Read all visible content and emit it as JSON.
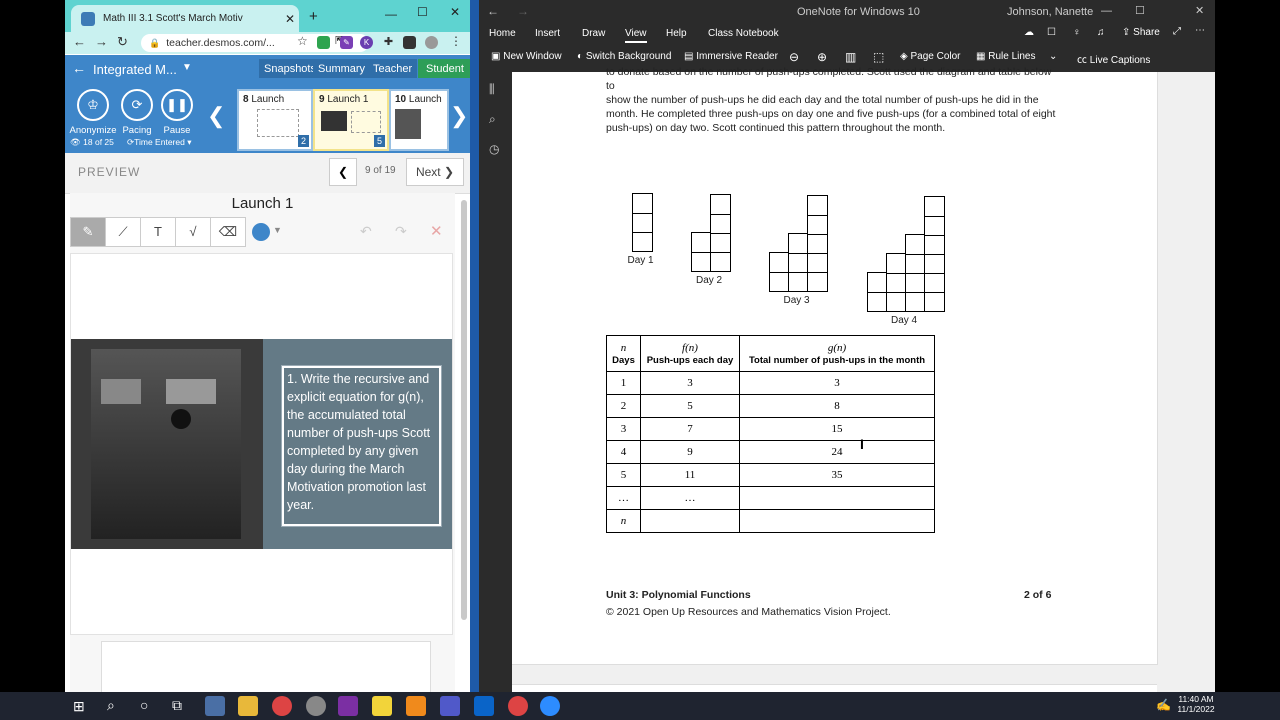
{
  "chrome": {
    "tab_title": "Math III 3.1 Scott's March Motiv",
    "url": "teacher.desmos.com/...",
    "new_tab": "+",
    "win_min": "—",
    "win_max": "☐",
    "win_close": "✕"
  },
  "desmos": {
    "activity_title": "Integrated M...",
    "tabs": [
      "Snapshots",
      "Summary",
      "Teacher",
      "Student"
    ],
    "tools": [
      {
        "label": "Anonymize",
        "icon": "♔"
      },
      {
        "label": "Pacing",
        "icon": "⟳"
      },
      {
        "label": "Pause",
        "icon": "❚❚"
      }
    ],
    "students_count": "18 of 25",
    "sort_label": "Time Entered",
    "slides": [
      {
        "num": "8",
        "name": "Launch",
        "count": "2"
      },
      {
        "num": "9",
        "name": "Launch 1",
        "count": "5"
      },
      {
        "num": "10",
        "name": "Launch",
        "count": ""
      }
    ],
    "preview_label": "PREVIEW",
    "page_indicator": "9 of 19",
    "next_label": "Next",
    "screen_title": "Launch 1",
    "sketch_tools": [
      "✎",
      "⟋",
      "T",
      "√",
      "⌫"
    ],
    "question": "1. Write the recursive and explicit equation for g(n), the accumulated total number of push-ups Scott completed by any given day during the March Motivation promotion last year."
  },
  "onenote": {
    "title": "OneNote for Windows 10",
    "user": "Johnson, Nanette",
    "menu": [
      "Home",
      "Insert",
      "Draw",
      "View",
      "Help",
      "Class Notebook"
    ],
    "share_label": "Share",
    "toolbar": [
      "New Window",
      "Switch Background",
      "Immersive Reader",
      "Page Color",
      "Rule Lines",
      "Live Captions"
    ],
    "paragraph": [
      "to donate based on the number of push-ups completed. Scott used the diagram and table below to",
      "show the number of push-ups he did each day and the total number of push-ups he did in the",
      "month. He completed three push-ups on day one and five push-ups (for a combined total of eight",
      "push-ups) on day two. Scott continued this pattern throughout the month."
    ],
    "day_labels": [
      "Day 1",
      "Day 2",
      "Day 3",
      "Day 4"
    ],
    "table": {
      "head_sym": [
        "n",
        "f(n)",
        "g(n)"
      ],
      "head_text": [
        "Days",
        "Push-ups each day",
        "Total number of push-ups in the month"
      ],
      "rows": [
        [
          "1",
          "3",
          "3"
        ],
        [
          "2",
          "5",
          "8"
        ],
        [
          "3",
          "7",
          "15"
        ],
        [
          "4",
          "9",
          "24"
        ],
        [
          "5",
          "11",
          "35"
        ],
        [
          "…",
          "…",
          ""
        ],
        [
          "n",
          "",
          ""
        ]
      ]
    },
    "footer_left": "Unit 3: Polynomial Functions",
    "footer_right": "2 of 6",
    "copyright": "© 2021 Open Up Resources and Mathematics Vision Project."
  },
  "taskbar": {
    "time": "11:40 AM",
    "date": "11/1/2022"
  }
}
